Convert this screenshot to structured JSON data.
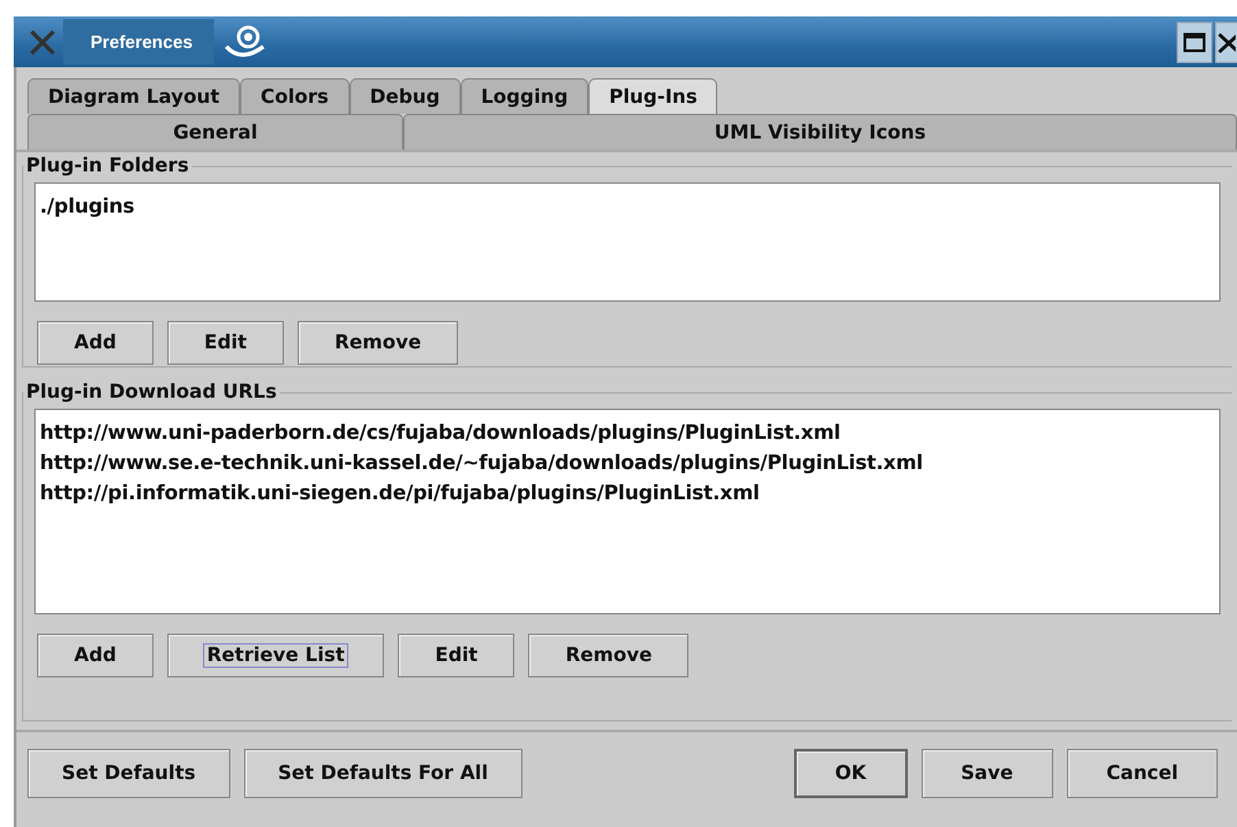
{
  "window": {
    "title": "Preferences"
  },
  "tab_rows": [
    [
      {
        "label": "Diagram Layout",
        "selected": false
      },
      {
        "label": "Colors",
        "selected": false
      },
      {
        "label": "Debug",
        "selected": false
      },
      {
        "label": "Logging",
        "selected": false
      },
      {
        "label": "Plug-Ins",
        "selected": true
      }
    ],
    [
      {
        "label": "General",
        "selected": false
      },
      {
        "label": "UML Visibility Icons",
        "selected": false
      }
    ]
  ],
  "sections": [
    {
      "title": "Plug-in Folders",
      "items": [
        "./plugins"
      ],
      "buttons": [
        {
          "label": "Add",
          "focused": false
        },
        {
          "label": "Edit",
          "focused": false
        },
        {
          "label": "Remove",
          "focused": false
        }
      ]
    },
    {
      "title": "Plug-in Download URLs",
      "items": [
        "http://www.uni-paderborn.de/cs/fujaba/downloads/plugins/PluginList.xml",
        "http://www.se.e-technik.uni-kassel.de/~fujaba/downloads/plugins/PluginList.xml",
        "http://pi.informatik.uni-siegen.de/pi/fujaba/plugins/PluginList.xml"
      ],
      "buttons": [
        {
          "label": "Add",
          "focused": false
        },
        {
          "label": "Retrieve List",
          "focused": true
        },
        {
          "label": "Edit",
          "focused": false
        },
        {
          "label": "Remove",
          "focused": false
        }
      ]
    }
  ],
  "footer": {
    "left_buttons": [
      {
        "label": "Set Defaults",
        "default": false
      },
      {
        "label": "Set Defaults For All",
        "default": false
      }
    ],
    "right_buttons": [
      {
        "label": "OK",
        "default": true
      },
      {
        "label": "Save",
        "default": false
      },
      {
        "label": "Cancel",
        "default": false
      }
    ]
  }
}
